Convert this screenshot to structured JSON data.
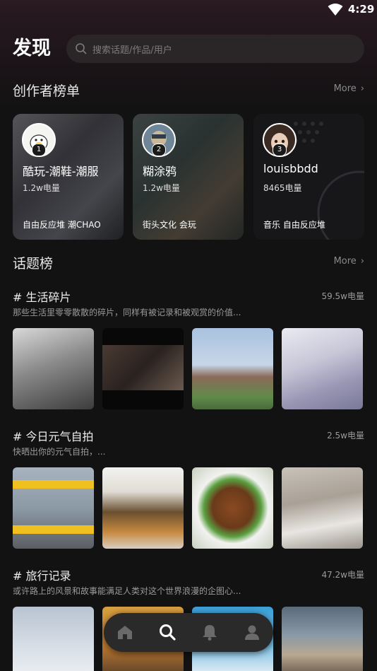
{
  "status": {
    "time": "4:29"
  },
  "header": {
    "title": "发现",
    "search_placeholder": "搜索话题/作品/用户"
  },
  "creators_section": {
    "title": "创作者榜单",
    "more": "More"
  },
  "creators": [
    {
      "rank": "1",
      "name": "酷玩-潮鞋-潮服",
      "energy": "1.2w电量",
      "tags": "自由反应堆  潮CHAO"
    },
    {
      "rank": "2",
      "name": "糊涂鸦",
      "energy": "1.2w电量",
      "tags": "街头文化  会玩"
    },
    {
      "rank": "3",
      "name": "louisbbdd",
      "energy": "8465电量",
      "tags": "音乐  自由反应堆"
    }
  ],
  "topics_section": {
    "title": "话题榜",
    "more": "More"
  },
  "topics": [
    {
      "title": "# 生活碎片",
      "energy": "59.5w电量",
      "desc": "那些生活里零零散散的碎片，同样有被记录和被观赏的价值..."
    },
    {
      "title": "# 今日元气自拍",
      "energy": "2.5w电量",
      "desc": "快晒出你的元气自拍，..."
    },
    {
      "title": "# 旅行记录",
      "energy": "47.2w电量",
      "desc": "或许路上的风景和故事能满足人类对这个世界浪漫的企图心..."
    }
  ],
  "tabbar": {
    "items": [
      "home",
      "discover",
      "notifications",
      "profile"
    ]
  }
}
